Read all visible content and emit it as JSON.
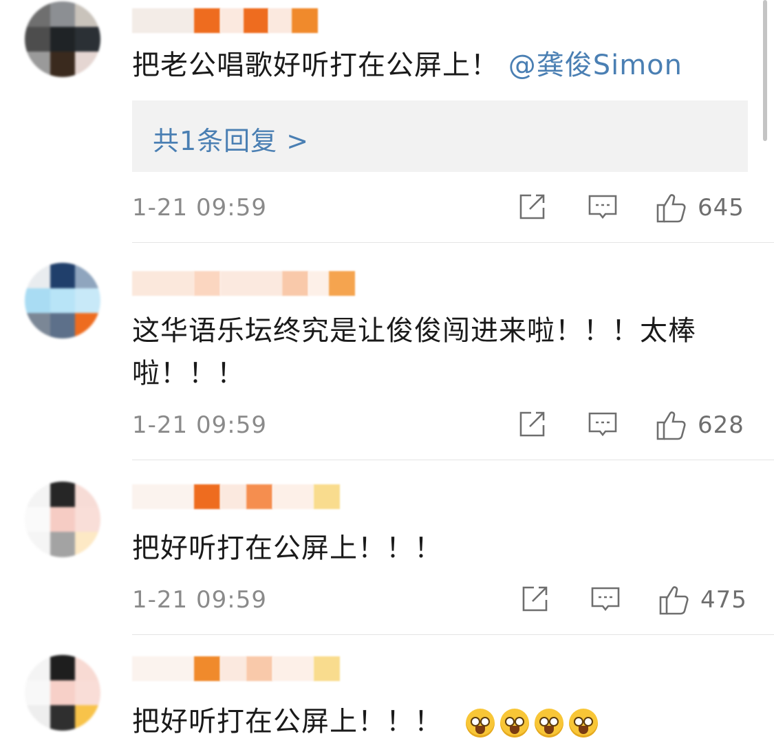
{
  "comments": [
    {
      "text": "把老公唱歌好听打在公屏上！",
      "mention": "@龚俊Simon",
      "reply_link": "共1条回复 >",
      "time": "1-21 09:59",
      "likes": "645"
    },
    {
      "text": "这华语乐坛终究是让俊俊闯进来啦！！！太棒啦！！！",
      "time": "1-21 09:59",
      "likes": "628"
    },
    {
      "text": "把好听打在公屏上！！！",
      "time": "1-21 09:59",
      "likes": "475"
    },
    {
      "text": "把好听打在公屏上！！！"
    }
  ],
  "icons": {
    "share": "share-icon",
    "comment": "comment-icon",
    "like": "thumbs-up-icon",
    "emoji": "hug-emoji-icon"
  },
  "colors": {
    "link": "#4a7fb3",
    "meta": "#8a8a8a",
    "reply_bg": "#f2f2f2"
  }
}
